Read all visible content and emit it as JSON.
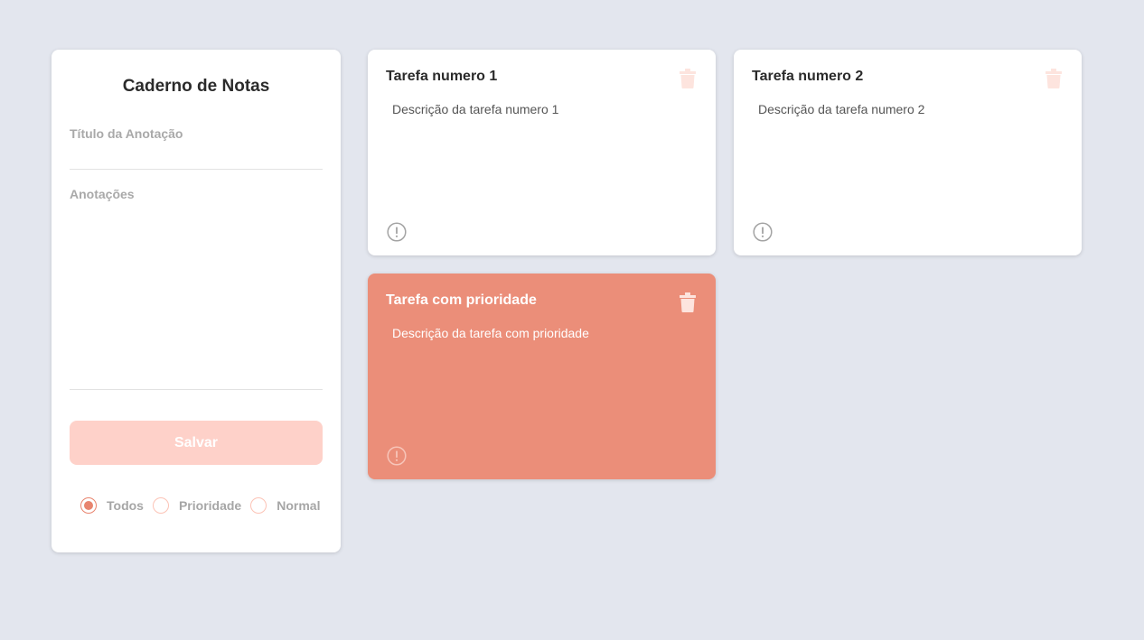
{
  "form": {
    "title": "Caderno de Notas",
    "title_placeholder": "Título da Anotação",
    "title_value": "",
    "notes_placeholder": "Anotações",
    "notes_value": "",
    "save_label": "Salvar",
    "filters": [
      {
        "label": "Todos",
        "selected": true
      },
      {
        "label": "Prioridade",
        "selected": false
      },
      {
        "label": "Normal",
        "selected": false
      }
    ]
  },
  "notes": [
    {
      "title": "Tarefa numero 1",
      "description": "Descrição da tarefa numero 1",
      "priority": false,
      "icons": [
        "trash-icon",
        "alert-icon"
      ]
    },
    {
      "title": "Tarefa numero 2",
      "description": "Descrição da tarefa numero 2",
      "priority": false,
      "icons": [
        "trash-icon",
        "alert-icon"
      ]
    },
    {
      "title": "Tarefa com prioridade",
      "description": "Descrição da tarefa com prioridade",
      "priority": true,
      "icons": [
        "trash-icon",
        "alert-icon"
      ]
    }
  ],
  "colors": {
    "background": "#e3e6ee",
    "accent": "#e8846e",
    "priority_card": "#eb8e79",
    "save_button": "#fed1c9",
    "icon_light": "#fde4de"
  }
}
